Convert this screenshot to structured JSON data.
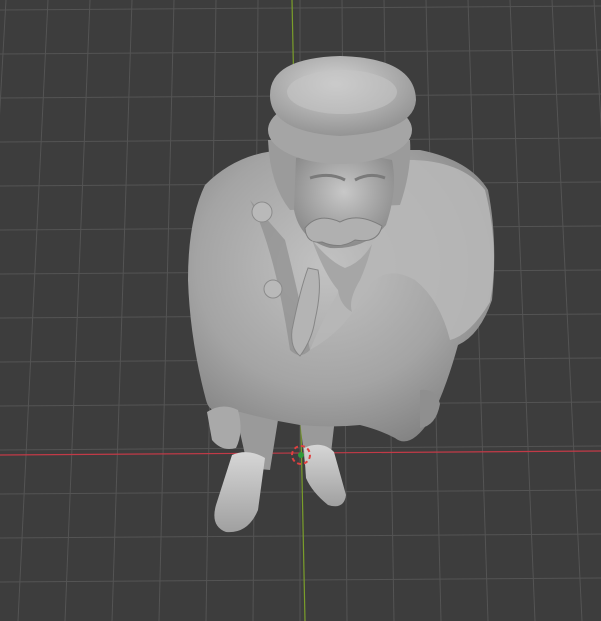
{
  "viewport": {
    "background_color": "#3d3d3d",
    "grid_color": "#545454",
    "x_axis_color": "#c23a47",
    "y_axis_color": "#7a9e2a",
    "model_color": "#a8a8a8",
    "model_shadow_color": "#6b6b6b",
    "model_highlight_color": "#cfcfcf",
    "origin_cursor_colors": [
      "#e04040",
      "#ffffff"
    ],
    "origin_marker_color": "#2d9a3a"
  },
  "scene": {
    "object": "sculpted-statue-bearded-man-with-cap-and-coat",
    "icons": [
      "3d-cursor-icon"
    ]
  }
}
